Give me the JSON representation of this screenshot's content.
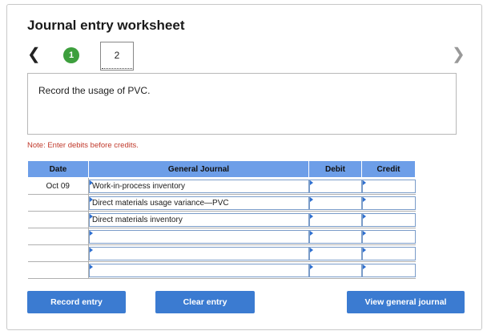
{
  "worksheet": {
    "title": "Journal entry worksheet",
    "nav_prev_icon": "chevron-left-icon",
    "nav_next_icon": "chevron-right-icon",
    "steps": [
      {
        "label": "1",
        "state": "completed",
        "color": "#3d9f3d"
      },
      {
        "label": "2",
        "state": "current"
      }
    ]
  },
  "instruction": "Record the usage of PVC.",
  "note": "Note: Enter debits before credits.",
  "table": {
    "headers": {
      "date": "Date",
      "account": "General Journal",
      "debit": "Debit",
      "credit": "Credit"
    },
    "header_color": "#6d9ee8",
    "rows": [
      {
        "date": "Oct 09",
        "account": "Work-in-process inventory",
        "debit": "",
        "credit": ""
      },
      {
        "date": "",
        "account": "Direct materials usage variance—PVC",
        "debit": "",
        "credit": ""
      },
      {
        "date": "",
        "account": "Direct materials inventory",
        "debit": "",
        "credit": ""
      },
      {
        "date": "",
        "account": "",
        "debit": "",
        "credit": ""
      },
      {
        "date": "",
        "account": "",
        "debit": "",
        "credit": ""
      },
      {
        "date": "",
        "account": "",
        "debit": "",
        "credit": ""
      }
    ]
  },
  "buttons": {
    "record": "Record entry",
    "clear": "Clear entry",
    "view": "View general journal",
    "color": "#3b7bd1"
  }
}
